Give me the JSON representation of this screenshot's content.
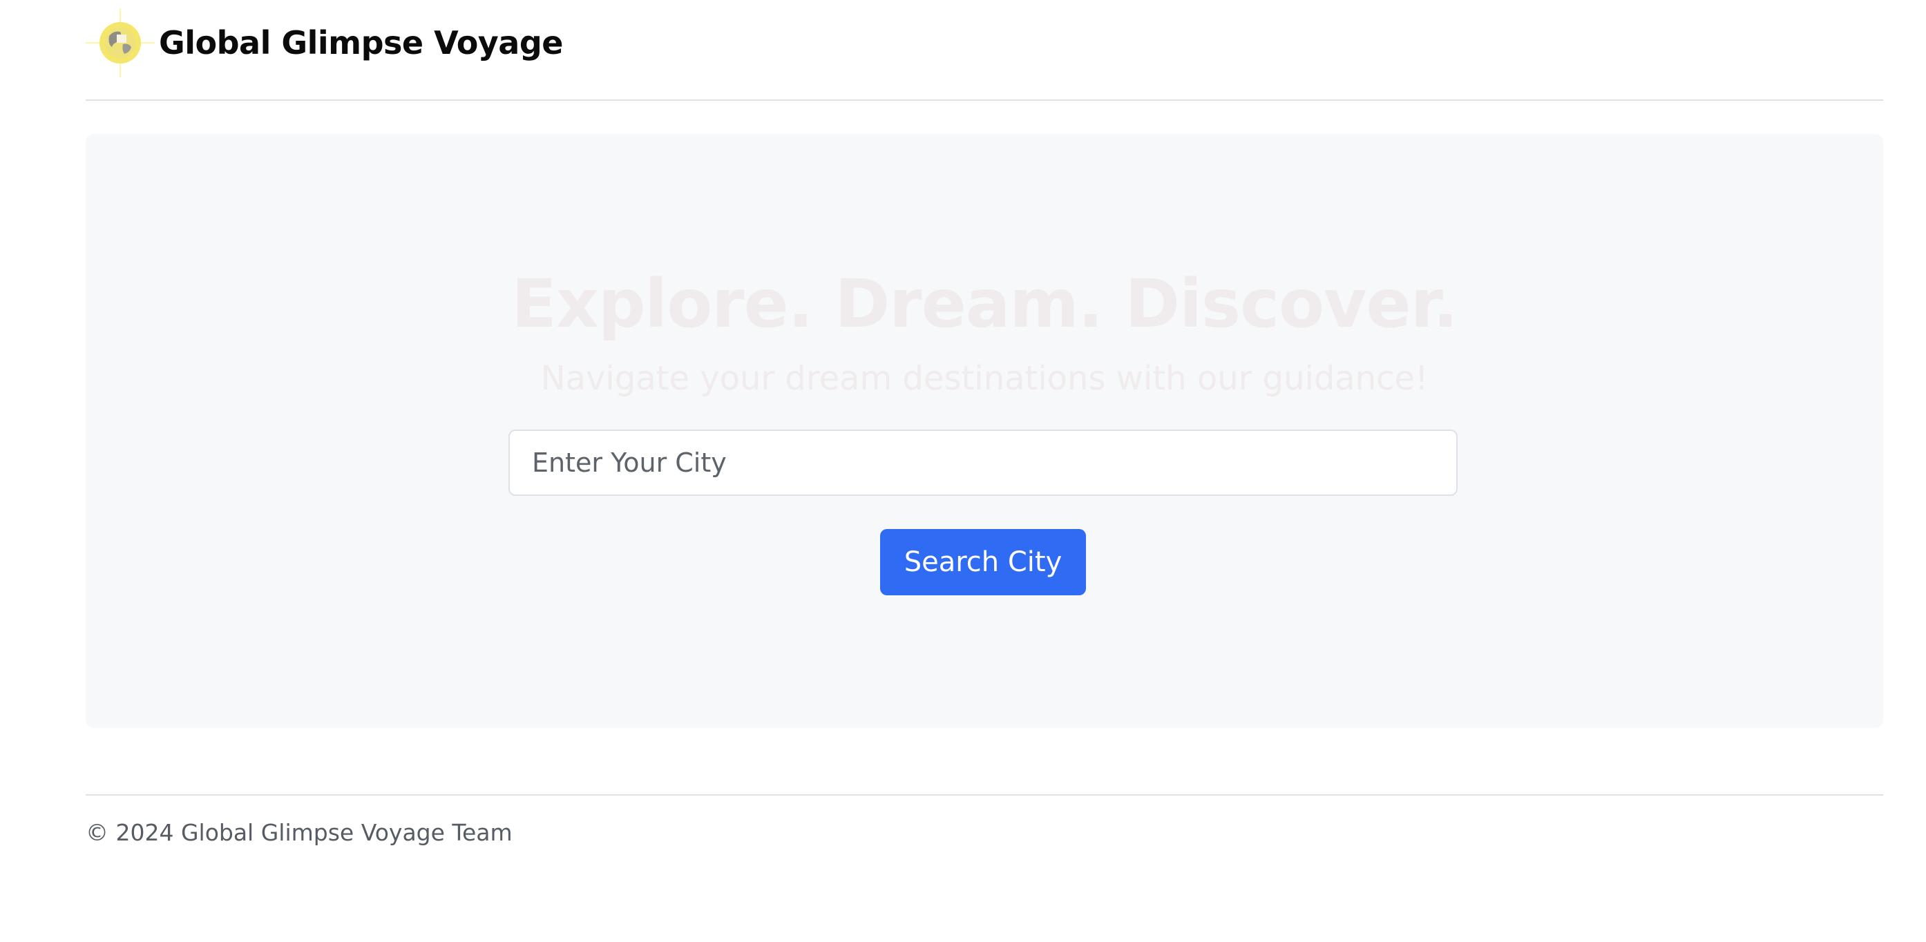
{
  "header": {
    "brand_name": "Global Glimpse Voyage",
    "logo_icon": "globe-logo-icon"
  },
  "hero": {
    "title": "Explore. Dream. Discover.",
    "subtitle": "Navigate your dream destinations with our guidance!",
    "city_input": {
      "placeholder": "Enter Your City",
      "value": ""
    },
    "search_button_label": "Search City"
  },
  "footer": {
    "copyright": "© 2024 Global Glimpse Voyage Team"
  },
  "colors": {
    "primary_button": "#2f6bf3",
    "hero_background": "#f7f8fa",
    "hero_text": "#f0ebec",
    "divider": "#dee2e6"
  }
}
